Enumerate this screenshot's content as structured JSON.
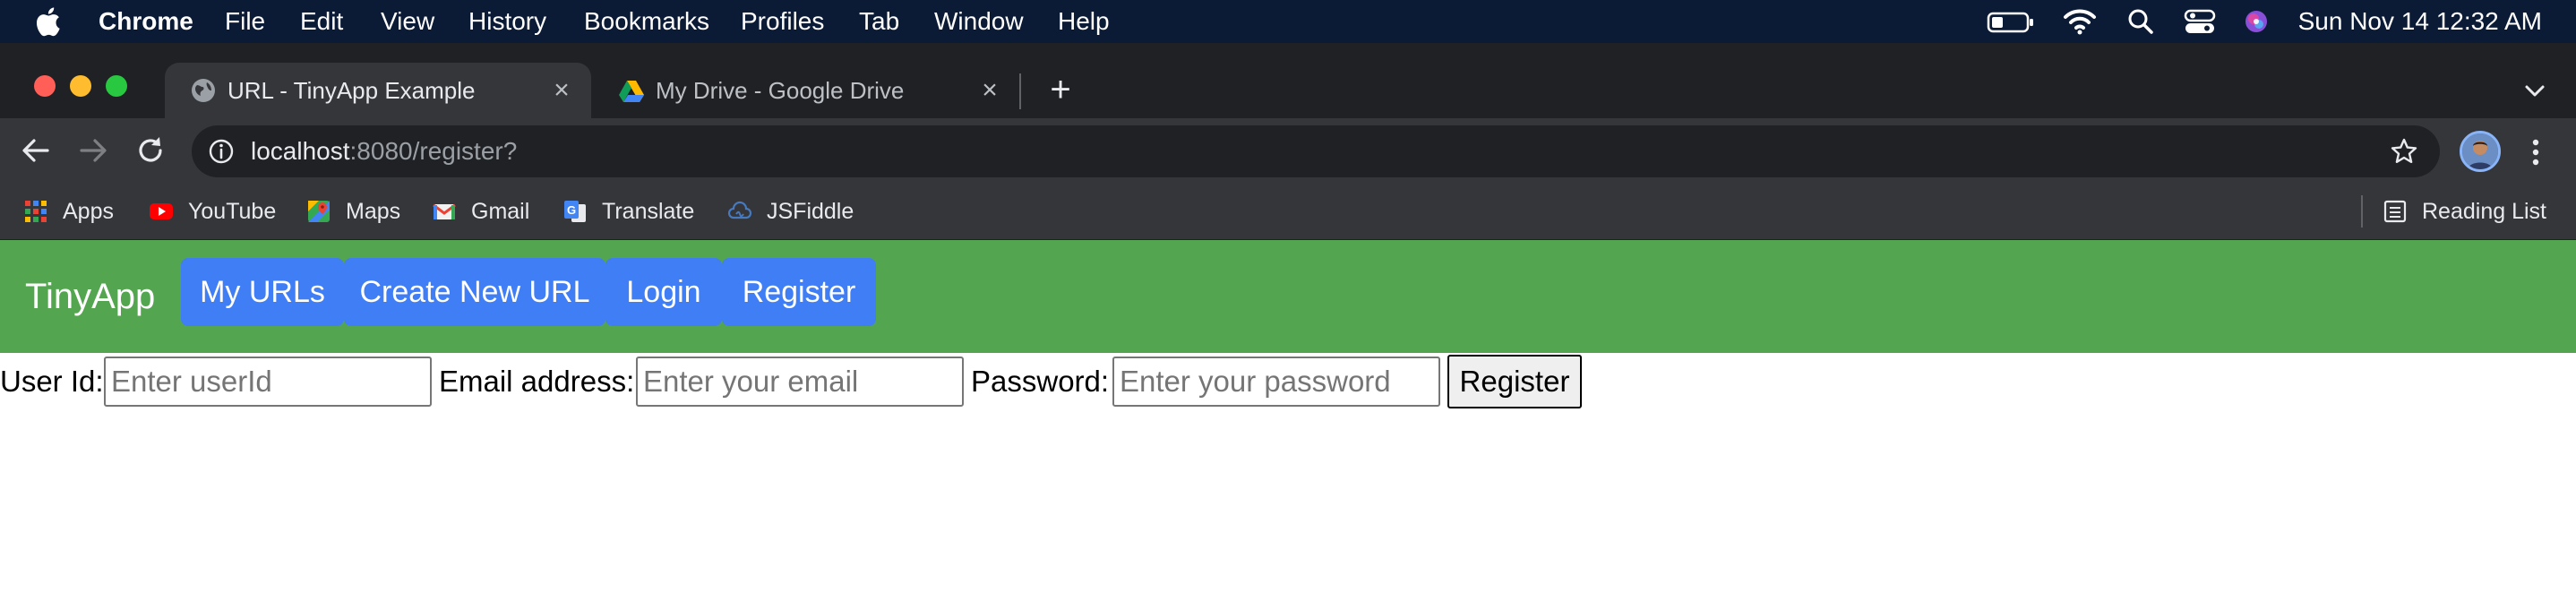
{
  "menubar": {
    "app_name": "Chrome",
    "items": [
      "File",
      "Edit",
      "View",
      "History",
      "Bookmarks",
      "Profiles",
      "Tab",
      "Window",
      "Help"
    ],
    "clock": "Sun Nov 14  12:32 AM"
  },
  "tabs": [
    {
      "title": "URL - TinyApp Example",
      "active": true,
      "icon": "globe-icon"
    },
    {
      "title": "My Drive - Google Drive",
      "active": false,
      "icon": "google-drive-icon"
    }
  ],
  "toolbar": {
    "url_host": "localhost",
    "url_path": ":8080/register?"
  },
  "bookmarks": {
    "items": [
      {
        "label": "Apps",
        "icon": "apps-grid-icon"
      },
      {
        "label": "YouTube",
        "icon": "youtube-icon"
      },
      {
        "label": "Maps",
        "icon": "maps-icon"
      },
      {
        "label": "Gmail",
        "icon": "gmail-icon"
      },
      {
        "label": "Translate",
        "icon": "translate-icon"
      },
      {
        "label": "JSFiddle",
        "icon": "jsfiddle-icon"
      }
    ],
    "reading_list": "Reading List"
  },
  "app": {
    "brand": "TinyApp",
    "nav": [
      "My URLs",
      "Create New URL",
      "Login",
      "Register"
    ],
    "colors": {
      "navbar": "#54a54f",
      "nav_button": "#3f7ef5"
    }
  },
  "form": {
    "user_id_label": "User Id:",
    "user_id_placeholder": "Enter userId",
    "email_label": "Email address:",
    "email_placeholder": "Enter your email",
    "password_label": "Password:",
    "password_placeholder": "Enter your password",
    "submit_label": "Register"
  }
}
